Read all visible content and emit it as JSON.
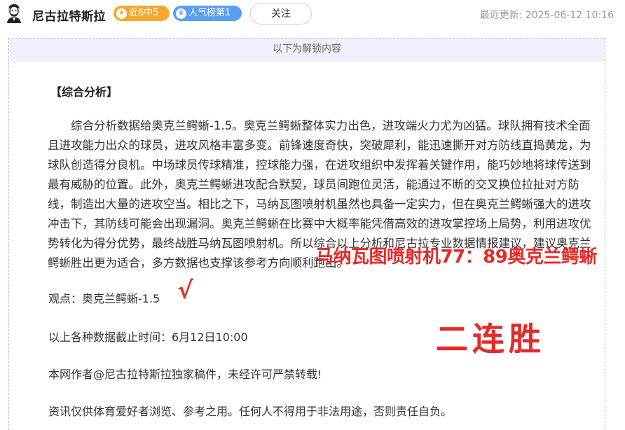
{
  "header": {
    "author_name": "尼古拉特斯拉",
    "badge_streak": "近6中5",
    "badge_rank": "人气榜第1",
    "follow_label": "关注",
    "updated_label": "最近更新:",
    "updated_time": "2025-06-12 10:16"
  },
  "content": {
    "unlock_label": "以下为解锁内容",
    "section_title": "【综合分析】",
    "analysis": "综合分析数据给奥克兰鳄蜥-1.5。奥克兰鳄蜥整体实力出色，进攻端火力尤为凶猛。球队拥有技术全面且进攻能力出众的球员，进攻风格丰富多变。前锋速度奇快，突破犀利，能迅速撕开对方防线直捣黄龙，为球队创造得分良机。中场球员传球精准，控球能力强，在进攻组织中发挥着关键作用，能巧妙地将球传送到最有威胁的位置。此外，奥克兰鳄蜥进攻配合默契，球员间跑位灵活，能通过不断的交叉换位拉扯对方防线，制造出大量的进攻空当。相比之下，马纳瓦图喷射机虽然也具备一定实力，但在奥克兰鳄蜥强大的进攻冲击下，其防线可能会出现漏洞。奥克兰鳄蜥在比赛中大概率能凭借高效的进攻掌控场上局势，利用进攻优势转化为得分优势，最终战胜马纳瓦图喷射机。所以综合以上分析和尼古拉专业数据情报建议，建议奥克兰鳄蜥胜出更为适合，多方数据也支撑该参考方向顺利跑出。",
    "viewpoint": "观点：奥克兰鳄蜥-1.5",
    "checkmark": "√",
    "cutoff": "以上各种数据截止时间：6月12日10:00",
    "copyright": "本网作者@尼古拉特斯拉独家稿件，未经许可严禁转载!",
    "disclaimer": "资讯仅供体育爱好者浏览、参考之用。任何人不得用于非法用途，否则责任自负。"
  },
  "overlay": {
    "score": "马纳瓦图喷射机77：89奥克兰鳄蜥",
    "streak": "二连胜",
    "color": "#e52a2a"
  },
  "icons": {
    "avatar": "tesla-portrait",
    "streak": "star-icon",
    "rank": "crown-icon"
  }
}
